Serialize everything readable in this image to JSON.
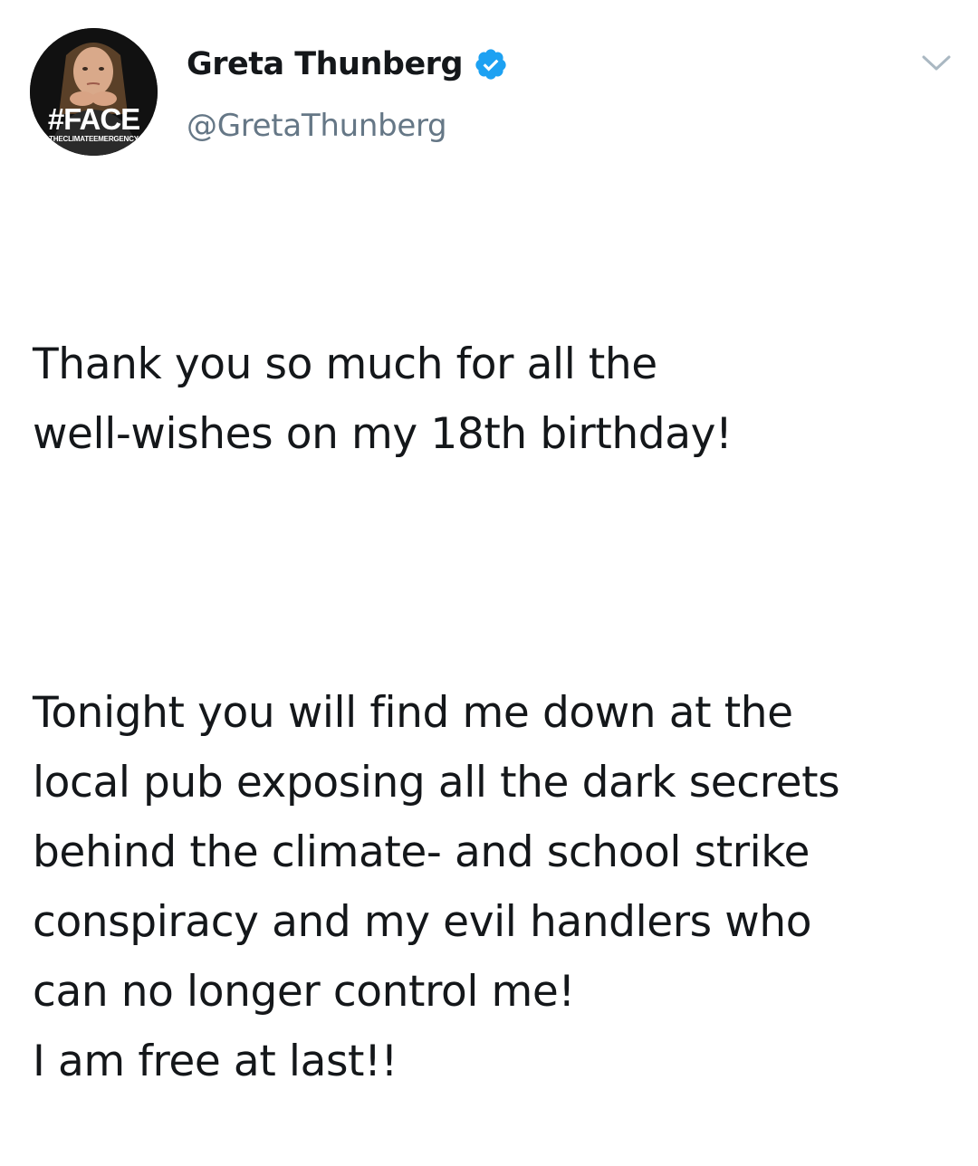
{
  "author": {
    "display_name": "Greta Thunberg",
    "handle": "@GretaThunberg",
    "verified": true,
    "avatar": {
      "overlay_title": "#FACE",
      "overlay_subtitle": "THECLIMATEEMERGENCY"
    }
  },
  "icons": {
    "verified": "verified-badge-icon",
    "menu": "chevron-down-icon"
  },
  "colors": {
    "verified_blue": "#1da1f2",
    "handle_gray": "#657786",
    "text": "#14171a",
    "chevron": "#aab8c2"
  },
  "tweet": {
    "paragraphs": [
      {
        "lines": [
          "Thank you so much for all the",
          "well-wishes on my 18th birthday!"
        ]
      },
      {
        "lines": [
          "Tonight you will find me down at the",
          "local pub exposing all the dark secrets",
          "behind the climate- and school strike",
          "conspiracy and my evil handlers who",
          "can no longer control me!",
          "I am free at last!!"
        ]
      }
    ]
  }
}
